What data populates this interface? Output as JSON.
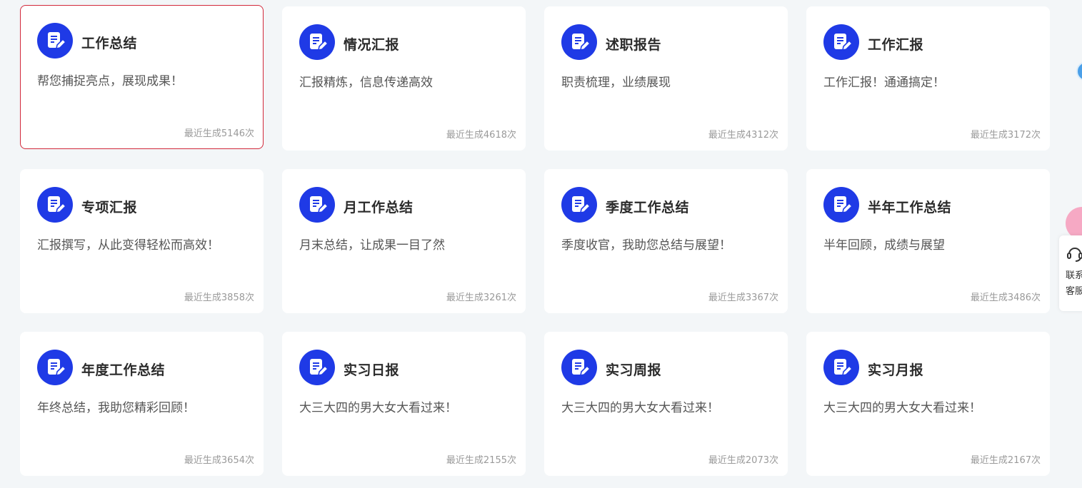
{
  "cards": [
    {
      "title": "工作总结",
      "desc": "帮您捕捉亮点，展现成果！",
      "count": "最近生成5146次",
      "active": true,
      "icon": "document-edit-icon"
    },
    {
      "title": "情况汇报",
      "desc": "汇报精炼，信息传递高效",
      "count": "最近生成4618次",
      "icon": "document-edit-icon"
    },
    {
      "title": "述职报告",
      "desc": "职责梳理，业绩展现",
      "count": "最近生成4312次",
      "icon": "document-edit-icon"
    },
    {
      "title": "工作汇报",
      "desc": "工作汇报！通通搞定！",
      "count": "最近生成3172次",
      "icon": "document-edit-icon"
    },
    {
      "title": "专项汇报",
      "desc": "汇报撰写，从此变得轻松而高效！",
      "count": "最近生成3858次",
      "icon": "document-edit-icon"
    },
    {
      "title": "月工作总结",
      "desc": "月末总结，让成果一目了然",
      "count": "最近生成3261次",
      "icon": "document-edit-icon"
    },
    {
      "title": "季度工作总结",
      "desc": "季度收官，我助您总结与展望！",
      "count": "最近生成3367次",
      "icon": "document-edit-icon"
    },
    {
      "title": "半年工作总结",
      "desc": "半年回顾，成绩与展望",
      "count": "最近生成3486次",
      "icon": "document-edit-icon"
    },
    {
      "title": "年度工作总结",
      "desc": "年终总结，我助您精彩回顾！",
      "count": "最近生成3654次",
      "icon": "document-edit-icon"
    },
    {
      "title": "实习日报",
      "desc": "大三大四的男大女大看过来！",
      "count": "最近生成2155次",
      "icon": "document-edit-icon"
    },
    {
      "title": "实习周报",
      "desc": "大三大四的男大女大看过来！",
      "count": "最近生成2073次",
      "icon": "document-edit-icon"
    },
    {
      "title": "实习月报",
      "desc": "大三大四的男大女大看过来！",
      "count": "最近生成2167次",
      "icon": "document-edit-icon"
    }
  ],
  "side": {
    "service_label": "联系客服",
    "service_icon": "headset-icon"
  },
  "colors": {
    "accent": "#1f3ae6",
    "active_border": "#d2283a",
    "background": "#f3f6f8"
  }
}
